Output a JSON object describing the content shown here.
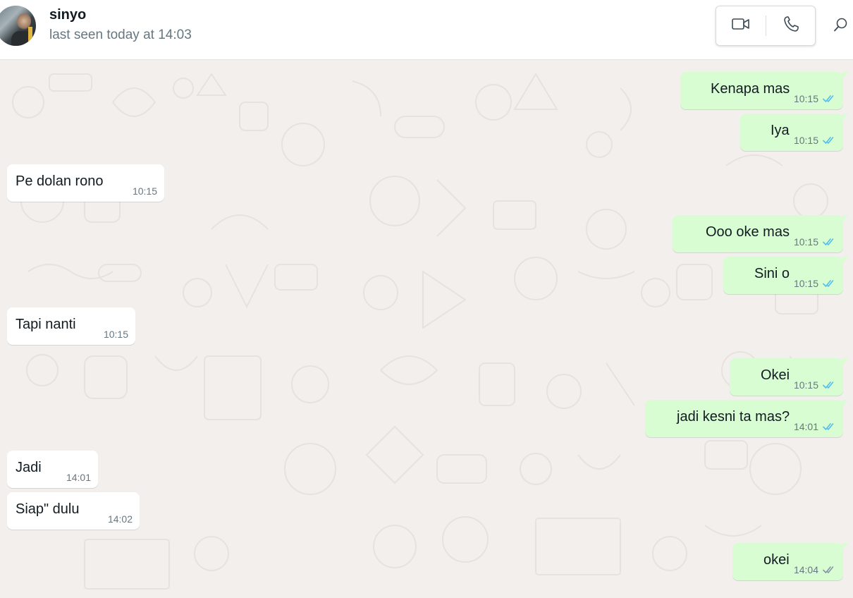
{
  "header": {
    "contact_name": "sinyo",
    "last_seen": "last seen today at 14:03",
    "avatar_icon": "avatar-photo",
    "video_call_icon": "video-camera-icon",
    "voice_call_icon": "phone-icon",
    "search_icon": "search-icon"
  },
  "colors": {
    "outgoing_bubble": "#d9fdd3",
    "incoming_bubble": "#ffffff",
    "read_tick": "#53bdeb",
    "delivered_tick": "#8696a0",
    "chat_background": "#f3efec"
  },
  "messages": [
    {
      "direction": "out",
      "text": "Kenapa mas",
      "time": "10:15",
      "status": "read"
    },
    {
      "direction": "out",
      "text": "Iya",
      "time": "10:15",
      "status": "read"
    },
    {
      "direction": "in",
      "text": "Pe dolan rono",
      "time": "10:15"
    },
    {
      "direction": "out",
      "text": "Ooo oke mas",
      "time": "10:15",
      "status": "read"
    },
    {
      "direction": "out",
      "text": "Sini o",
      "time": "10:15",
      "status": "read"
    },
    {
      "direction": "in",
      "text": "Tapi nanti",
      "time": "10:15"
    },
    {
      "direction": "out",
      "text": "Okei",
      "time": "10:15",
      "status": "read"
    },
    {
      "direction": "out",
      "text": "jadi kesni ta mas?",
      "time": "14:01",
      "status": "read"
    },
    {
      "direction": "in",
      "text": "Jadi",
      "time": "14:01"
    },
    {
      "direction": "in",
      "text": "Siap\" dulu",
      "time": "14:02"
    },
    {
      "direction": "out",
      "text": "okei",
      "time": "14:04",
      "status": "delivered"
    }
  ]
}
